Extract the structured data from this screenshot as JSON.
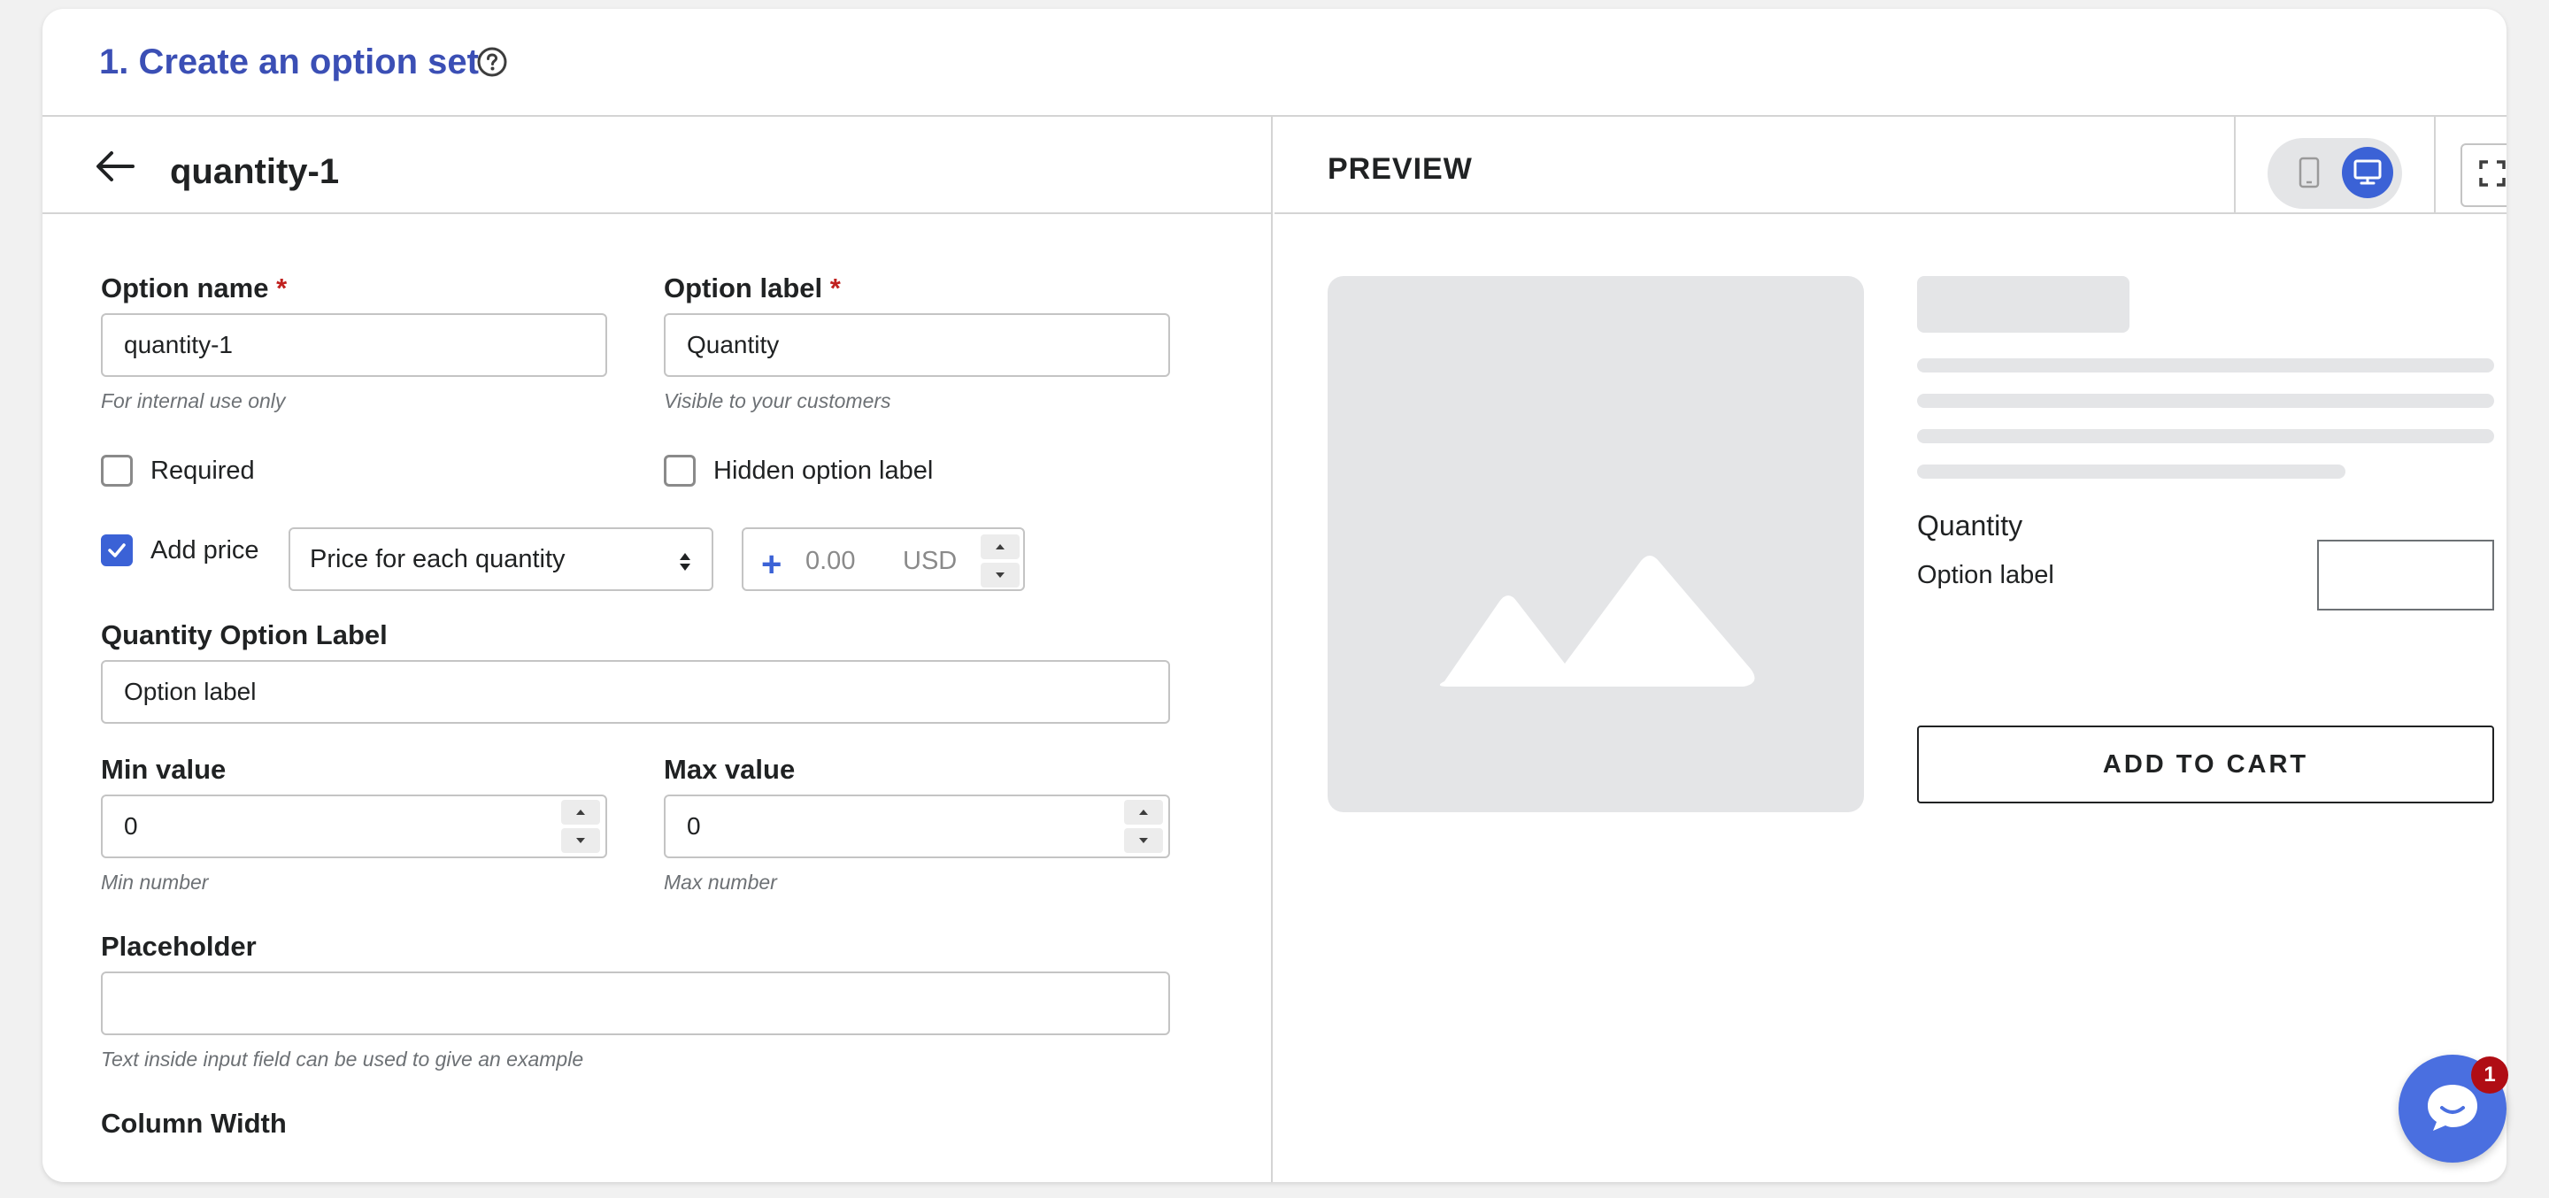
{
  "card": {
    "title": "1. Create an option set",
    "help_icon": "question-circle-icon"
  },
  "editor": {
    "back_icon": "arrow-left-icon",
    "title": "quantity-1"
  },
  "form": {
    "option_name": {
      "label": "Option name",
      "required_mark": "*",
      "value": "quantity-1",
      "help": "For internal use only"
    },
    "option_label": {
      "label": "Option label",
      "required_mark": "*",
      "value": "Quantity",
      "help": "Visible to your customers"
    },
    "required_checkbox": {
      "label": "Required",
      "checked": false
    },
    "hidden_label_checkbox": {
      "label": "Hidden option label",
      "checked": false
    },
    "add_price": {
      "label": "Add price",
      "checked": true,
      "price_type": "Price for each quantity",
      "sign": "+",
      "amount_placeholder": "0.00",
      "currency": "USD"
    },
    "quantity_option_label": {
      "label": "Quantity Option Label",
      "value": "Option label"
    },
    "min_value": {
      "label": "Min value",
      "value": "0",
      "help": "Min number"
    },
    "max_value": {
      "label": "Max value",
      "value": "0",
      "help": "Max number"
    },
    "placeholder": {
      "label": "Placeholder",
      "value": "",
      "help": "Text inside input field can be used to give an example"
    },
    "column_width": {
      "label": "Column Width"
    }
  },
  "preview": {
    "title": "PREVIEW",
    "device_mobile_icon": "mobile-icon",
    "device_desktop_icon": "desktop-icon",
    "selected_device": "desktop",
    "fullscreen_icon": "fullscreen-icon",
    "image_icon": "image-placeholder-icon",
    "quantity_label": "Quantity",
    "option_label": "Option label",
    "add_to_cart": "ADD TO CART"
  },
  "chat": {
    "icon": "chat-icon",
    "badge_count": "1"
  },
  "colors": {
    "accent": "#3b62d6",
    "title_blue": "#3b4fb5",
    "required_red": "#c0211f",
    "chat_blue": "#4a6fe0",
    "badge_red": "#b00d14"
  }
}
